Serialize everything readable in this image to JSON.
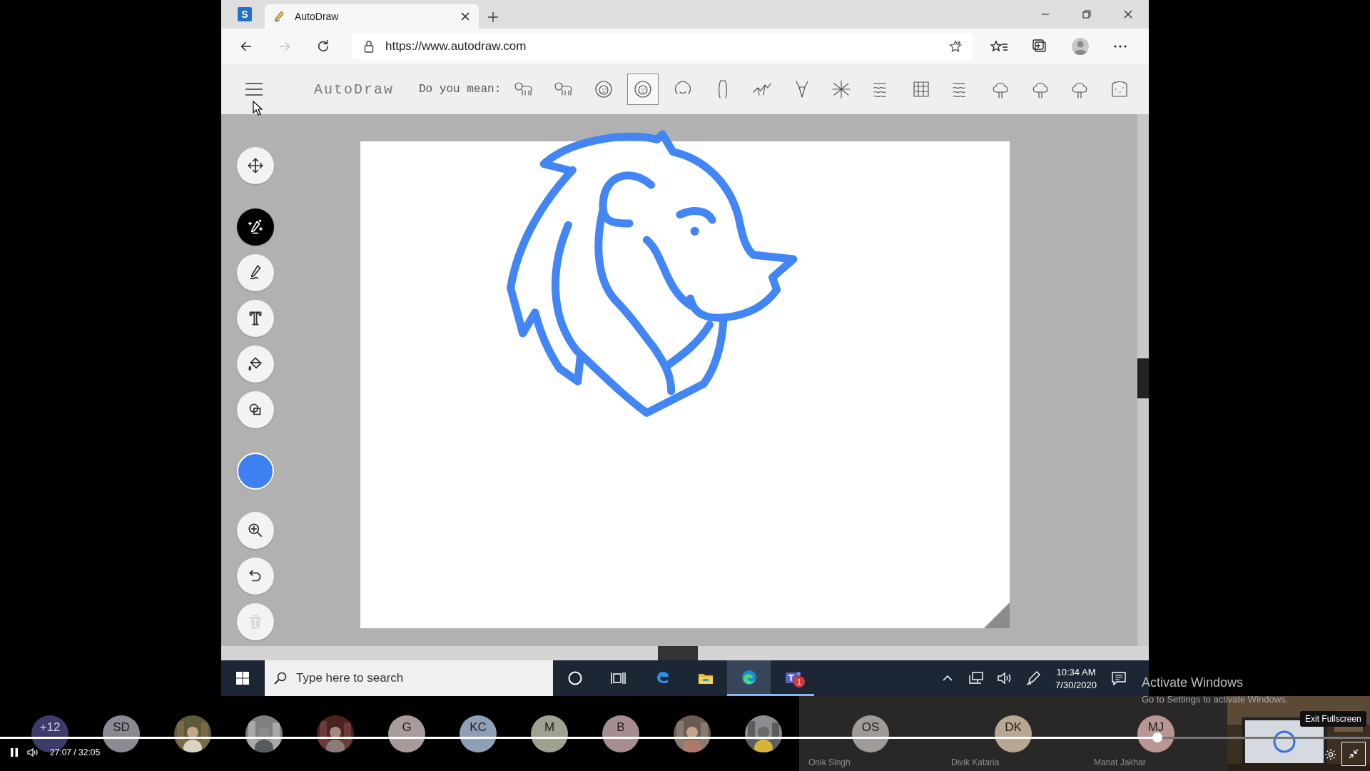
{
  "browser": {
    "pinned_tab": {
      "label": "S"
    },
    "tabs": [
      {
        "title": "AutoDraw",
        "selected": true
      }
    ],
    "nav": [
      {
        "kind": "back",
        "disabled": false
      },
      {
        "kind": "forward",
        "disabled": true
      },
      {
        "kind": "reload",
        "disabled": false
      }
    ],
    "address": "https://www.autodraw.com"
  },
  "autodraw": {
    "logo": "AutoDraw",
    "prompt": "Do you mean:",
    "suggestions": [
      {
        "selected": false
      },
      {
        "selected": false
      },
      {
        "selected": false
      },
      {
        "selected": true
      },
      {
        "selected": false
      },
      {
        "selected": false
      },
      {
        "selected": false
      },
      {
        "selected": false
      },
      {
        "selected": false
      },
      {
        "selected": false
      },
      {
        "selected": false
      },
      {
        "selected": false
      },
      {
        "selected": false
      },
      {
        "selected": false
      },
      {
        "selected": false
      },
      {
        "selected": false
      }
    ],
    "tools": [
      {
        "kind": "move",
        "selected": false,
        "disabled": false
      },
      {
        "kind": "autodraw",
        "selected": true,
        "disabled": false
      },
      {
        "kind": "draw",
        "selected": false,
        "disabled": false
      },
      {
        "kind": "type",
        "selected": false,
        "disabled": false
      },
      {
        "kind": "fill",
        "selected": false,
        "disabled": false
      },
      {
        "kind": "shape",
        "selected": false,
        "disabled": false
      },
      {
        "kind": "color",
        "selected": false,
        "disabled": false,
        "color": "#3f80f0"
      },
      {
        "kind": "zoom",
        "selected": false,
        "disabled": false
      },
      {
        "kind": "undo",
        "selected": false,
        "disabled": false
      },
      {
        "kind": "delete",
        "selected": false,
        "disabled": true
      }
    ]
  },
  "taskbar": {
    "search_placeholder": "Type here to search",
    "apps": [
      {
        "kind": "edge-legacy",
        "running": false,
        "selected": false
      },
      {
        "kind": "explorer",
        "running": false,
        "selected": false
      },
      {
        "kind": "edge",
        "running": true,
        "selected": true
      },
      {
        "kind": "teams",
        "running": true,
        "selected": false,
        "badge": "1"
      }
    ],
    "time": "10:34 AM",
    "date": "7/30/2020"
  },
  "watermark": {
    "title": "Activate Windows",
    "hint": "Go to Settings to activate Windows."
  },
  "call": {
    "participants": [
      {
        "kind": "initials",
        "initials": "+12",
        "color": "#3d3b6b"
      },
      {
        "kind": "initials",
        "initials": "SD",
        "color": "#8b8a92"
      },
      {
        "kind": "picture"
      },
      {
        "kind": "picture"
      },
      {
        "kind": "picture"
      },
      {
        "kind": "initials",
        "initials": "G",
        "color": "#a89c9a"
      },
      {
        "kind": "initials",
        "initials": "KC",
        "color": "#8f9fb6"
      },
      {
        "kind": "initials",
        "initials": "M",
        "color": "#9fa291"
      },
      {
        "kind": "initials",
        "initials": "B",
        "color": "#a68d90"
      },
      {
        "kind": "picture"
      },
      {
        "kind": "picture"
      },
      {
        "kind": "initials",
        "initials": "OS",
        "color": "#9e9b99",
        "name": "Onik Singh"
      },
      {
        "kind": "initials",
        "initials": "DK",
        "color": "#b8a793",
        "name": "Divik Kataria"
      },
      {
        "kind": "initials",
        "initials": "MJ",
        "color": "#b99691",
        "name": "Manat Jakhar"
      }
    ],
    "player": {
      "playing": true,
      "level": 0.845,
      "time": "27:07 / 32:05",
      "tooltip": "Exit Fullscreen"
    }
  }
}
